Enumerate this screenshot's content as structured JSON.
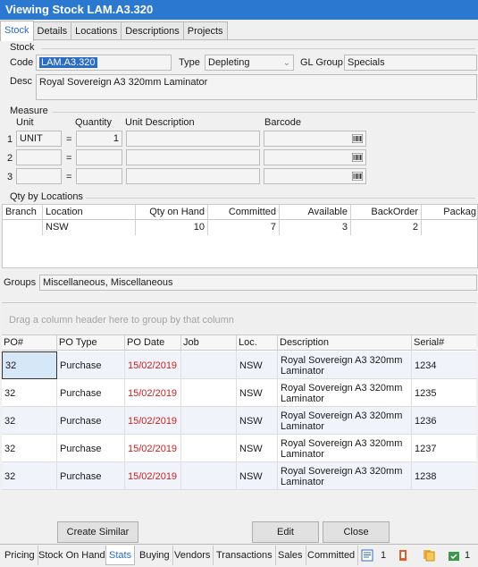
{
  "window": {
    "title": "Viewing Stock LAM.A3.320"
  },
  "tabs": [
    "Stock",
    "Details",
    "Locations",
    "Descriptions",
    "Projects"
  ],
  "stock": {
    "group_title": "Stock",
    "code_label": "Code",
    "code_value": "LAM.A3.320",
    "type_label": "Type",
    "type_value": "Depleting",
    "gl_group_label": "GL Group",
    "gl_group_value": "Specials",
    "desc_label": "Desc",
    "desc_value": "Royal Sovereign A3 320mm Laminator"
  },
  "measure": {
    "group_title": "Measure",
    "headers": {
      "unit": "Unit",
      "quantity": "Quantity",
      "unit_description": "Unit Description",
      "barcode": "Barcode"
    },
    "rows": [
      {
        "n": "1",
        "unit": "UNIT",
        "eq": "=",
        "quantity": "1",
        "unit_description": "",
        "barcode": ""
      },
      {
        "n": "2",
        "unit": "",
        "eq": "=",
        "quantity": "",
        "unit_description": "",
        "barcode": ""
      },
      {
        "n": "3",
        "unit": "",
        "eq": "=",
        "quantity": "",
        "unit_description": "",
        "barcode": ""
      }
    ]
  },
  "qty_by_locations": {
    "group_title": "Qty by Locations",
    "columns": [
      "Branch",
      "Location",
      "Qty on Hand",
      "Committed",
      "Available",
      "BackOrder",
      "Packag"
    ],
    "rows": [
      {
        "branch": "",
        "location": "NSW",
        "qty_on_hand": "10",
        "committed": "7",
        "available": "3",
        "backorder": "2",
        "package": ""
      }
    ]
  },
  "groups": {
    "label": "Groups",
    "value": "Miscellaneous, Miscellaneous"
  },
  "po_grid": {
    "drag_hint": "Drag a column header here to group by that column",
    "columns": [
      "PO#",
      "PO Type",
      "PO Date",
      "Job",
      "Loc.",
      "Description",
      "Serial#"
    ],
    "rows": [
      {
        "po": "32",
        "type": "Purchase",
        "date": "15/02/2019",
        "job": "",
        "loc": "NSW",
        "desc1": "Royal Sovereign A3 320mm",
        "desc2": "Laminator",
        "serial": "1234"
      },
      {
        "po": "32",
        "type": "Purchase",
        "date": "15/02/2019",
        "job": "",
        "loc": "NSW",
        "desc1": "Royal Sovereign A3 320mm",
        "desc2": "Laminator",
        "serial": "1235"
      },
      {
        "po": "32",
        "type": "Purchase",
        "date": "15/02/2019",
        "job": "",
        "loc": "NSW",
        "desc1": "Royal Sovereign A3 320mm",
        "desc2": "Laminator",
        "serial": "1236"
      },
      {
        "po": "32",
        "type": "Purchase",
        "date": "15/02/2019",
        "job": "",
        "loc": "NSW",
        "desc1": "Royal Sovereign A3 320mm",
        "desc2": "Laminator",
        "serial": "1237"
      },
      {
        "po": "32",
        "type": "Purchase",
        "date": "15/02/2019",
        "job": "",
        "loc": "NSW",
        "desc1": "Royal Sovereign A3 320mm",
        "desc2": "Laminator",
        "serial": "1238"
      }
    ]
  },
  "buttons": {
    "create_similar": "Create Similar",
    "edit": "Edit",
    "close": "Close"
  },
  "bottom_tabs": [
    "Pricing",
    "Stock On Hand",
    "Stats",
    "Buying",
    "Vendors",
    "Transactions",
    "Sales",
    "Committed"
  ],
  "bottom_icons": [
    {
      "icon": "notes-icon",
      "count": "1"
    },
    {
      "icon": "attachment-icon",
      "count": ""
    },
    {
      "icon": "documents-icon",
      "count": ""
    },
    {
      "icon": "tasks-icon",
      "count": "1"
    }
  ],
  "colors": {
    "title_bar": "#2b78d0",
    "accent": "#2b6cc4",
    "date_red": "#cc1f1f"
  }
}
